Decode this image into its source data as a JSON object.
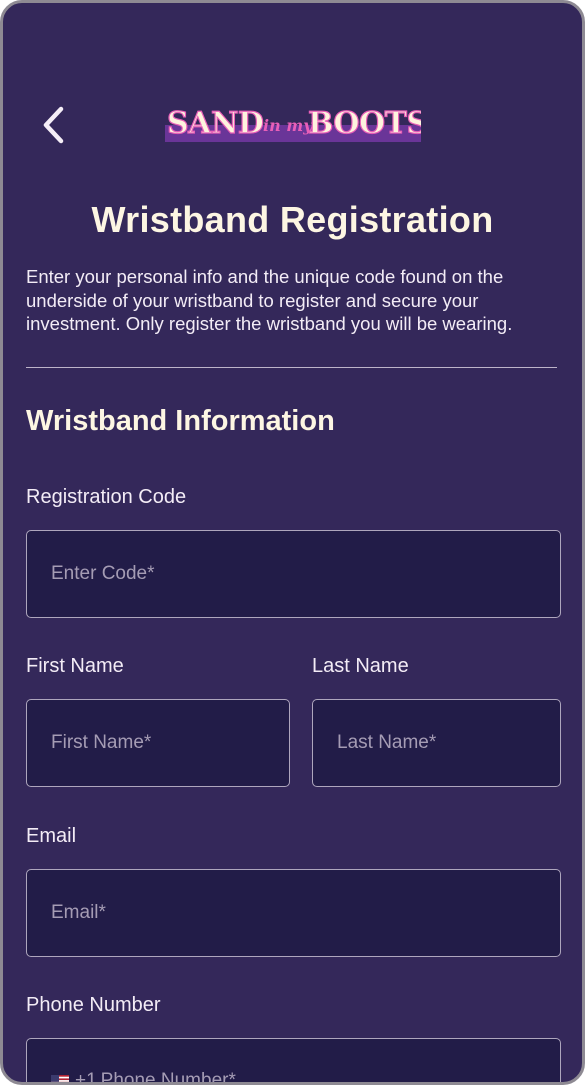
{
  "header": {
    "back_icon": "chevron-left-icon",
    "logo": {
      "sand": "SAND",
      "in_my": "in my",
      "boots": "BOOTS"
    }
  },
  "page": {
    "title": "Wristband Registration",
    "intro": "Enter your personal info and the unique code found on the underside of your wristband to register and secure your investment. Only register the wristband you will be wearing."
  },
  "section": {
    "title": "Wristband Information"
  },
  "form": {
    "registration_code": {
      "label": "Registration Code",
      "placeholder": "Enter Code*",
      "value": ""
    },
    "first_name": {
      "label": "First Name",
      "placeholder": "First Name*",
      "value": ""
    },
    "last_name": {
      "label": "Last Name",
      "placeholder": "Last Name*",
      "value": ""
    },
    "email": {
      "label": "Email",
      "placeholder": "Email*",
      "value": ""
    },
    "phone": {
      "label": "Phone Number",
      "flag_icon": "us-flag-icon",
      "country_code": "+1",
      "placeholder": "Phone Number*",
      "value": ""
    }
  },
  "colors": {
    "background": "#34285a",
    "field_background": "#221c48",
    "field_border": "#aea6bd",
    "title_text": "#fdf6e3",
    "logo_pink": "#e85fb8",
    "logo_cream": "#fdf3de",
    "logo_bar": "#6a3598"
  }
}
